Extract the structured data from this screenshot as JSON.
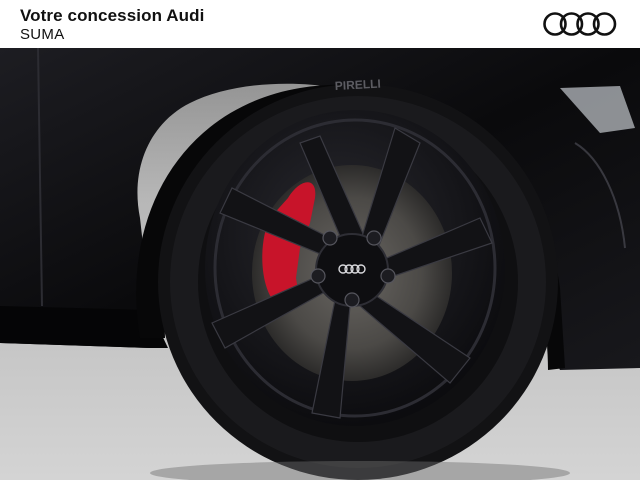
{
  "header": {
    "title": "Votre concession Audi",
    "subtitle": "SUMA",
    "logo_icon": "audi-rings-logo"
  },
  "photo": {
    "subject": "car-wheel-closeup",
    "tire_brand": "PIRELLI",
    "colors": {
      "body": "#0b0b0d",
      "caliper": "#c8142a",
      "floor": "#c9c9c9",
      "rim": "#141417"
    }
  }
}
